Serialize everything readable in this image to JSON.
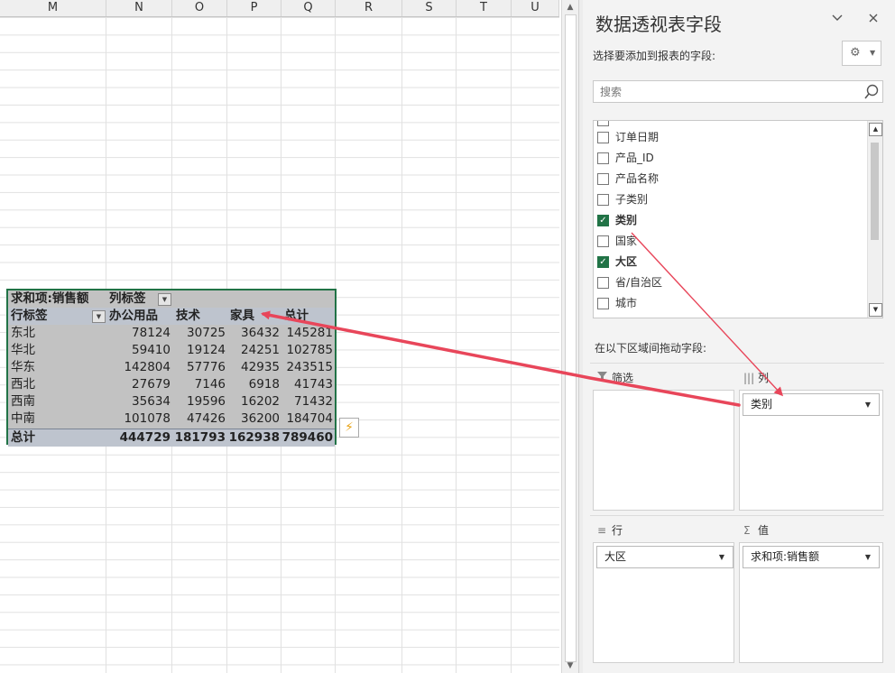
{
  "columns": [
    "M",
    "N",
    "O",
    "P",
    "Q",
    "R",
    "S",
    "T",
    "U"
  ],
  "pivot": {
    "sum_label": "求和项:销售额",
    "col_label": "列标签",
    "row_label": "行标签",
    "col_headers": [
      "办公用品",
      "技术",
      "家具",
      "总计"
    ],
    "rows": [
      {
        "region": "东北",
        "v": [
          "78124",
          "30725",
          "36432",
          "145281"
        ]
      },
      {
        "region": "华北",
        "v": [
          "59410",
          "19124",
          "24251",
          "102785"
        ]
      },
      {
        "region": "华东",
        "v": [
          "142804",
          "57776",
          "42935",
          "243515"
        ]
      },
      {
        "region": "西北",
        "v": [
          "27679",
          "7146",
          "6918",
          "41743"
        ]
      },
      {
        "region": "西南",
        "v": [
          "35634",
          "19596",
          "16202",
          "71432"
        ]
      },
      {
        "region": "中南",
        "v": [
          "101078",
          "47426",
          "36200",
          "184704"
        ]
      }
    ],
    "total": {
      "label": "总计",
      "v": [
        "444729",
        "181793",
        "162938",
        "789460"
      ]
    }
  },
  "panel": {
    "title": "数据透视表字段",
    "choose_label": "选择要添加到报表的字段:",
    "search_placeholder": "搜索",
    "fields": [
      {
        "label": "订单日期",
        "checked": false
      },
      {
        "label": "产品_ID",
        "checked": false
      },
      {
        "label": "产品名称",
        "checked": false
      },
      {
        "label": "子类别",
        "checked": false
      },
      {
        "label": "类别",
        "checked": true
      },
      {
        "label": "国家",
        "checked": false
      },
      {
        "label": "大区",
        "checked": true
      },
      {
        "label": "省/自治区",
        "checked": false
      },
      {
        "label": "城市",
        "checked": false
      }
    ],
    "drag_label": "在以下区域间拖动字段:",
    "areas": {
      "filter": {
        "label": "筛选",
        "chips": []
      },
      "columns": {
        "label": "列",
        "chips": [
          "类别"
        ]
      },
      "rows": {
        "label": "行",
        "chips": [
          "大区"
        ]
      },
      "values": {
        "label": "值",
        "chips": [
          "求和项:销售额"
        ]
      }
    }
  },
  "colors": {
    "accent": "#217346",
    "arrow": "#e8465a"
  }
}
